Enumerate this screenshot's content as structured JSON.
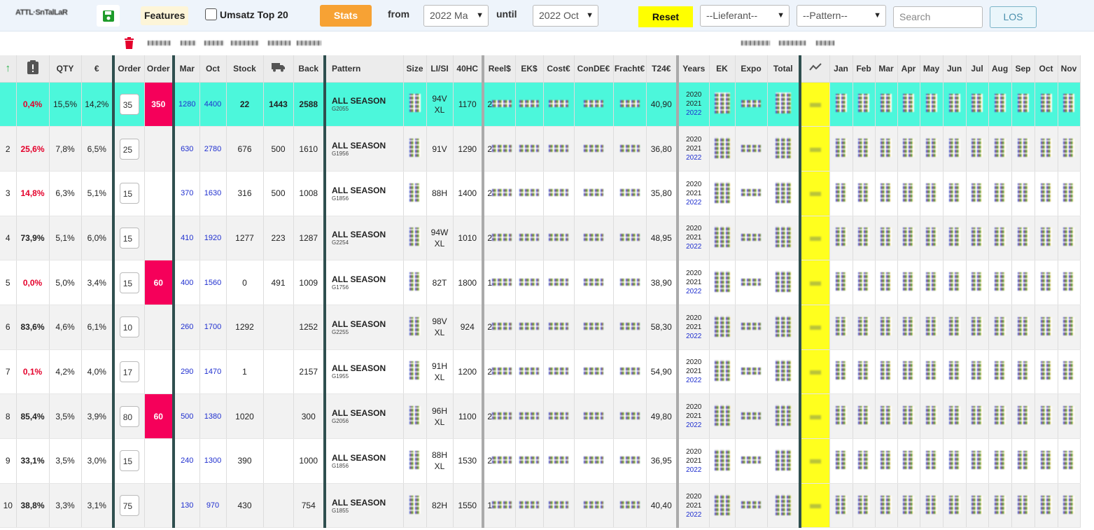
{
  "toolbar": {
    "features_label": "Features",
    "top20_label": "Umsatz Top 20",
    "stats_label": "Stats",
    "from_label": "from",
    "from_value": "2022 Ma",
    "until_label": "until",
    "until_value": "2022 Oct",
    "reset_label": "Reset",
    "lieferant_value": "--Lieferant--",
    "pattern_value": "--Pattern--",
    "search_placeholder": "Search",
    "los_label": "LOS"
  },
  "columns": [
    "",
    "",
    "QTY",
    "€",
    "Order",
    "Order",
    "Mar",
    "Oct",
    "Stock",
    "",
    "Back",
    "Pattern",
    "Size",
    "LI/SI",
    "40HC",
    "Reel$",
    "EK$",
    "Cost€",
    "ConDE€",
    "Fracht€",
    "T24€",
    "Years",
    "EK",
    "Expo",
    "Total",
    "",
    "Jan",
    "Feb",
    "Mar",
    "Apr",
    "May",
    "Jun",
    "Jul",
    "Aug",
    "Sep",
    "Oct",
    "Nov"
  ],
  "rows": [
    {
      "a": "",
      "pct": "0,4%",
      "qty": "15,5%",
      "eur": "14,2%",
      "order_in": "35",
      "order": "350",
      "mar": "1280",
      "oct": "4400",
      "stock": "22",
      "truck": "1443",
      "back": "2588",
      "pattern": "ALL SEASON",
      "pcode": "G2055",
      "size": "",
      "lisi": "94V\nXL",
      "hc": "1170",
      "reel": "2",
      "t24": "40,90"
    },
    {
      "a": "2",
      "pct": "25,6%",
      "qty": "7,8%",
      "eur": "6,5%",
      "order_in": "25",
      "order": "",
      "mar": "630",
      "oct": "2780",
      "stock": "676",
      "truck": "500",
      "back": "1610",
      "pattern": "ALL SEASON",
      "pcode": "G1956",
      "size": "",
      "lisi": "91V",
      "hc": "1290",
      "reel": "2",
      "t24": "36,80"
    },
    {
      "a": "3",
      "pct": "14,8%",
      "qty": "6,3%",
      "eur": "5,1%",
      "order_in": "15",
      "order": "",
      "mar": "370",
      "oct": "1630",
      "stock": "316",
      "truck": "500",
      "back": "1008",
      "pattern": "ALL SEASON",
      "pcode": "G1856",
      "size": "",
      "lisi": "88H",
      "hc": "1400",
      "reel": "2",
      "t24": "35,80"
    },
    {
      "a": "4",
      "pct": "73,9%",
      "qty": "5,1%",
      "eur": "6,0%",
      "order_in": "15",
      "order": "",
      "mar": "410",
      "oct": "1920",
      "stock": "1277",
      "truck": "223",
      "back": "1287",
      "pattern": "ALL SEASON",
      "pcode": "G2254",
      "size": "",
      "lisi": "94W\nXL",
      "hc": "1010",
      "reel": "2",
      "t24": "48,95"
    },
    {
      "a": "5",
      "pct": "0,0%",
      "qty": "5,0%",
      "eur": "3,4%",
      "order_in": "15",
      "order": "60",
      "mar": "400",
      "oct": "1560",
      "stock": "0",
      "truck": "491",
      "back": "1009",
      "pattern": "ALL SEASON",
      "pcode": "G1756",
      "size": "",
      "lisi": "82T",
      "hc": "1800",
      "reel": "1",
      "t24": "38,90"
    },
    {
      "a": "6",
      "pct": "83,6%",
      "qty": "4,6%",
      "eur": "6,1%",
      "order_in": "10",
      "order": "",
      "mar": "260",
      "oct": "1700",
      "stock": "1292",
      "truck": "",
      "back": "1252",
      "pattern": "ALL SEASON",
      "pcode": "G2255",
      "size": "",
      "lisi": "98V\nXL",
      "hc": "924",
      "reel": "2",
      "t24": "58,30"
    },
    {
      "a": "7",
      "pct": "0,1%",
      "qty": "4,2%",
      "eur": "4,0%",
      "order_in": "17",
      "order": "",
      "mar": "290",
      "oct": "1470",
      "stock": "1",
      "truck": "",
      "back": "2157",
      "pattern": "ALL SEASON",
      "pcode": "G1955",
      "size": "",
      "lisi": "91H\nXL",
      "hc": "1200",
      "reel": "2",
      "t24": "54,90"
    },
    {
      "a": "8",
      "pct": "85,4%",
      "qty": "3,5%",
      "eur": "3,9%",
      "order_in": "80",
      "order": "60",
      "mar": "500",
      "oct": "1380",
      "stock": "1020",
      "truck": "",
      "back": "300",
      "pattern": "ALL SEASON",
      "pcode": "G2056",
      "size": "",
      "lisi": "96H\nXL",
      "hc": "1100",
      "reel": "2",
      "t24": "49,80"
    },
    {
      "a": "9",
      "pct": "33,1%",
      "qty": "3,5%",
      "eur": "3,0%",
      "order_in": "15",
      "order": "",
      "mar": "240",
      "oct": "1300",
      "stock": "390",
      "truck": "",
      "back": "1000",
      "pattern": "ALL SEASON",
      "pcode": "G1856",
      "size": "",
      "lisi": "88H\nXL",
      "hc": "1530",
      "reel": "2",
      "t24": "36,95"
    },
    {
      "a": "10",
      "pct": "38,8%",
      "qty": "3,3%",
      "eur": "3,1%",
      "order_in": "75",
      "order": "",
      "mar": "130",
      "oct": "970",
      "stock": "430",
      "truck": "",
      "back": "754",
      "pattern": "ALL SEASON",
      "pcode": "G1855",
      "size": "",
      "lisi": "82H",
      "hc": "1550",
      "reel": "1",
      "t24": "40,40"
    }
  ],
  "years": [
    "2020",
    "2021",
    "2022"
  ],
  "colors": {
    "highlight": "#4cf7db",
    "order_red": "#f5005a",
    "trend_yellow": "#ffff1e",
    "stats_orange": "#f7a234",
    "reset_yellow": "#ffff00",
    "sep_dark": "#2f4f4f"
  }
}
